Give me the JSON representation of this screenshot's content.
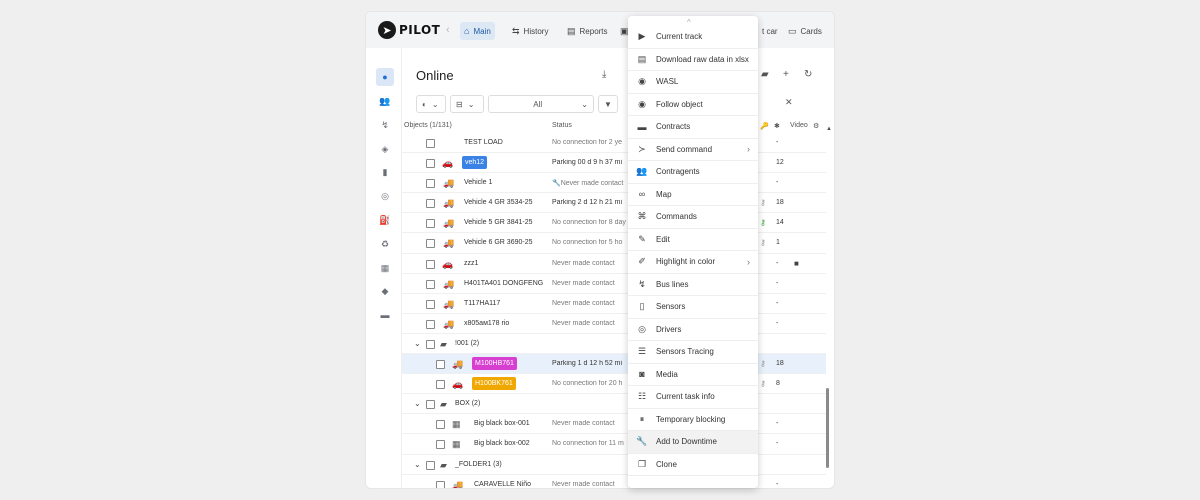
{
  "app": {
    "logo_text": "PILOT"
  },
  "topbar": {
    "tabs": [
      {
        "label": "Main",
        "icon": "home-icon"
      },
      {
        "label": "History",
        "icon": "route-icon"
      },
      {
        "label": "Reports",
        "icon": "report-icon"
      },
      {
        "label": "t car",
        "icon": "car-icon"
      },
      {
        "label": "Cards",
        "icon": "card-icon"
      }
    ]
  },
  "page": {
    "title": "Online"
  },
  "filters": {
    "status_value": "All"
  },
  "columns": {
    "objects": "Objects (1/131)",
    "status": "Status",
    "video": "Video"
  },
  "rows": [
    {
      "name": "TEST LOAD",
      "status": "No connection for 2 ye",
      "num": "-"
    },
    {
      "name": "veh12",
      "status": "Parking 00 d 9 h 37 mi",
      "num": "12"
    },
    {
      "name": "Vehicle 1",
      "status": "Never made contact",
      "num": "-"
    },
    {
      "name": "Vehicle 4 GR 3534-25",
      "status": "Parking 2 d 12 h 21 mi",
      "num": "18"
    },
    {
      "name": "Vehicle 5 GR 3841-25",
      "status": "No connection for 8 day",
      "num": "14"
    },
    {
      "name": "Vehicle 6 GR 3690-25",
      "status": "No connection for 5 ho",
      "num": "1"
    },
    {
      "name": "zzz1",
      "status": "Never made contact",
      "num": "-"
    },
    {
      "name": "H401TA401 DONGFENG",
      "status": "Never made contact",
      "num": "-"
    },
    {
      "name": "T117HA117",
      "status": "Never made contact",
      "num": "-"
    },
    {
      "name": "x805aм178 rio",
      "status": "Never made contact",
      "num": "-"
    },
    {
      "name": "!001 (2)"
    },
    {
      "name": "M100HB761",
      "status": "Parking 1 d 12 h 52 mi",
      "num": "18"
    },
    {
      "name": "H100BK761",
      "status": "No connection for 20 h",
      "num": "8"
    },
    {
      "name": "BOX (2)"
    },
    {
      "name": "Big black box-001",
      "status": "Never made contact",
      "num": "-"
    },
    {
      "name": "Big black box-002",
      "status": "No connection for 11 m",
      "num": "-"
    },
    {
      "name": "_FOLDER1 (3)"
    },
    {
      "name": "CARAVELLE Niño",
      "status": "Never made contact",
      "num": "-"
    }
  ],
  "colors": {
    "accent": "#1f6fd6",
    "tag_blue": "#3b82e6",
    "tag_magenta": "#d63fd0",
    "tag_orange": "#f0a800",
    "key_green": "#3aa53a"
  },
  "context_menu": {
    "items": [
      {
        "label": "Current track",
        "icon": "play-icon"
      },
      {
        "label": "Download raw data in xlsx",
        "icon": "file-icon"
      },
      {
        "label": "WASL",
        "icon": "eye-icon"
      },
      {
        "label": "Follow object",
        "icon": "eye-icon"
      },
      {
        "label": "Contracts",
        "icon": "briefcase-icon"
      },
      {
        "label": "Send command",
        "icon": "terminal-icon",
        "submenu": true
      },
      {
        "label": "Contragents",
        "icon": "users-icon"
      },
      {
        "label": "Map",
        "icon": "binoculars-icon"
      },
      {
        "label": "Commands",
        "icon": "command-icon"
      },
      {
        "label": "Edit",
        "icon": "edit-icon"
      },
      {
        "label": "Highlight in color",
        "icon": "marker-icon",
        "submenu": true
      },
      {
        "label": "Bus lines",
        "icon": "route-icon"
      },
      {
        "label": "Sensors",
        "icon": "sensor-icon"
      },
      {
        "label": "Drivers",
        "icon": "steering-icon"
      },
      {
        "label": "Sensors Tracing",
        "icon": "list-icon"
      },
      {
        "label": "Media",
        "icon": "camera-icon"
      },
      {
        "label": "Current task info",
        "icon": "tasks-icon"
      },
      {
        "label": "Temporary blocking",
        "icon": "pause-icon"
      },
      {
        "label": "Add to Downtime",
        "icon": "wrench-icon"
      },
      {
        "label": "Clone",
        "icon": "clone-icon"
      }
    ]
  }
}
